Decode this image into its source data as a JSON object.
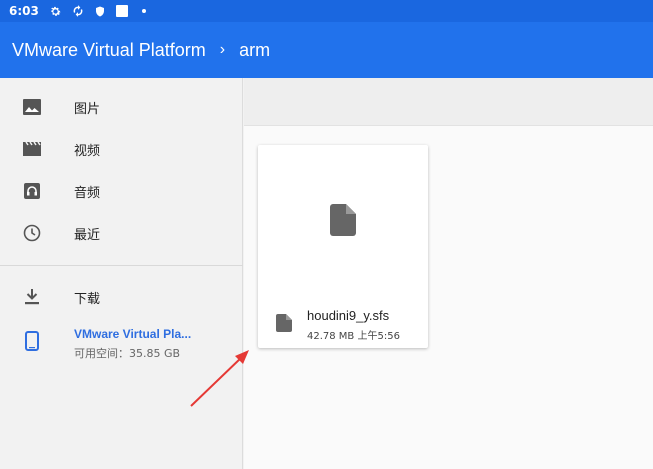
{
  "status_bar": {
    "time": "6:03",
    "icons": [
      "gear-icon",
      "sync-icon",
      "shield-icon",
      "a-badge-icon",
      "dot-icon"
    ],
    "badge_letter": "A"
  },
  "app_bar": {
    "root": "VMware Virtual Platform",
    "separator": "›",
    "current": "arm"
  },
  "sidebar": {
    "roots": [
      {
        "icon": "image-icon",
        "label": "图片"
      },
      {
        "icon": "video-icon",
        "label": "视频"
      },
      {
        "icon": "audio-icon",
        "label": "音频"
      },
      {
        "icon": "recent-icon",
        "label": "最近"
      }
    ],
    "downloads": {
      "icon": "download-icon",
      "label": "下载"
    },
    "device": {
      "icon": "phone-icon",
      "name": "VMware Virtual Pla...",
      "free_space": "可用空间：35.85 GB"
    }
  },
  "files": [
    {
      "icon": "file-icon",
      "name": "houdini9_y.sfs",
      "meta": "42.78 MB 上午5:56"
    }
  ],
  "colors": {
    "status_bar": "#1a67e0",
    "app_bar": "#2172ec",
    "device_accent": "#2f6ee0",
    "annotation_arrow": "#e53935"
  }
}
